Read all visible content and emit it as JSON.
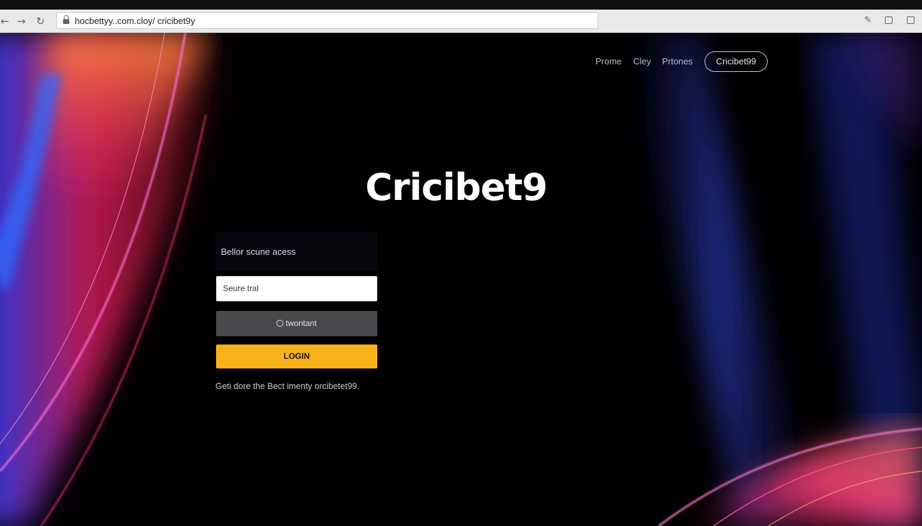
{
  "browser": {
    "url": "hocbettyy..com.cloy/ cricibet9y",
    "back_icon": "back-arrow-icon",
    "forward_icon": "forward-arrow-icon",
    "reload_icon": "reload-icon",
    "lock_icon": "lock-icon"
  },
  "nav": {
    "links": [
      "Prome",
      "Cley",
      "Prtones"
    ],
    "pill_label": "Cricibet99"
  },
  "hero": {
    "title": "Cricibet9"
  },
  "login": {
    "heading": "Bellor scune acess",
    "input_placeholder": "Seure tral",
    "option_label": "twontant",
    "login_label": "LOGIN",
    "footer": "Geti dore the Bect imenty orcibetet99."
  },
  "colors": {
    "accent": "#f7b217",
    "background": "#000000",
    "option_bg": "#48494c"
  }
}
